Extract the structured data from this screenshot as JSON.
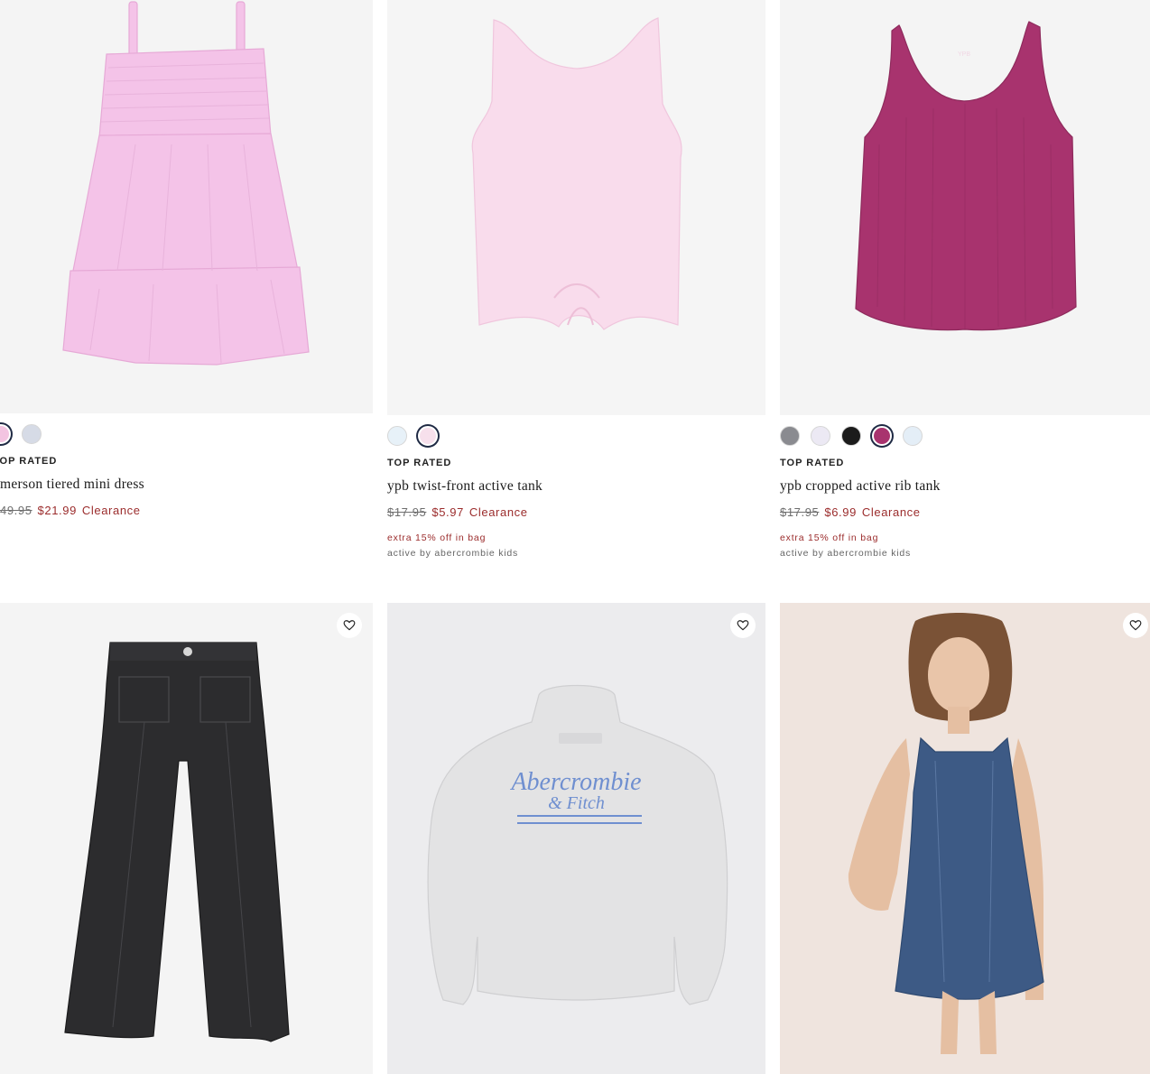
{
  "products": [
    {
      "id": "p1",
      "badge": "TOP RATED",
      "name": "merson tiered mini dress",
      "old_price": "49.95",
      "new_price": "$21.99",
      "clearance": "Clearance",
      "swatches": [
        "#f3c4e1",
        "#d6dbe6"
      ],
      "selected_swatch": 0
    },
    {
      "id": "p2",
      "badge": "TOP RATED",
      "name": "ypb twist-front active tank",
      "old_price": "$17.95",
      "new_price": "$5.97",
      "clearance": "Clearance",
      "promo": "extra 15% off in bag",
      "brand": "active by abercrombie kids",
      "swatches": [
        "#e7f1f8",
        "#f7e0ec"
      ],
      "selected_swatch": 1
    },
    {
      "id": "p3",
      "badge": "TOP RATED",
      "name": "ypb cropped active rib tank",
      "old_price": "$17.95",
      "new_price": "$6.99",
      "clearance": "Clearance",
      "promo": "extra 15% off in bag",
      "brand": "active by abercrombie kids",
      "swatches": [
        "#8a8b90",
        "#ece9f4",
        "#1b1b1b",
        "#a8336e",
        "#e4eef7"
      ],
      "selected_swatch": 3
    }
  ],
  "row2": {
    "sweatshirt_print_line1": "Abercrombie",
    "sweatshirt_print_line2": "& Fitch"
  },
  "icons": {
    "favorite": "heart-icon"
  },
  "colors": {
    "sale": "#9b2c2c",
    "selected_ring": "#1f2a44"
  }
}
